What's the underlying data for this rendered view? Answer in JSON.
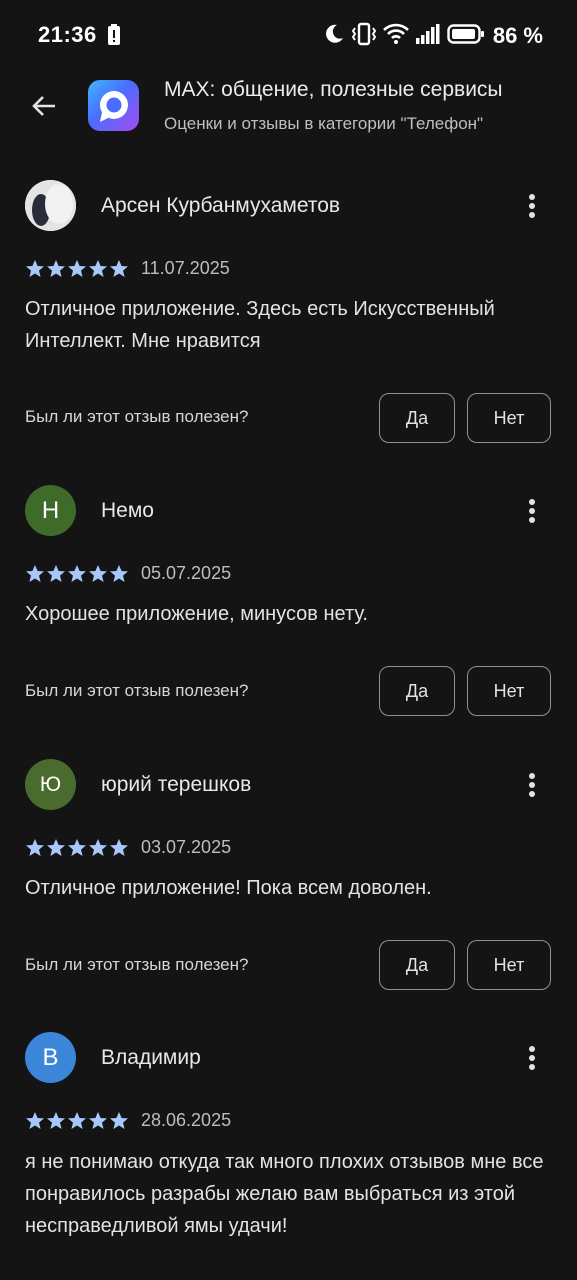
{
  "status": {
    "time": "21:36",
    "battery": "86 %"
  },
  "header": {
    "back_icon": "arrow-back-icon",
    "app_name": "MAX: общение, полезные сервисы",
    "subtitle": "Оценки и отзывы в категории \"Телефон\""
  },
  "colors": {
    "background": "#141414",
    "star": "#a8c7fa",
    "avatar_nemo": "#3e6b2a",
    "avatar_yuriy": "#4a6b2e",
    "avatar_vladimir": "#3b86d8"
  },
  "helpful_prompt": "Был ли этот отзыв полезен?",
  "yes_label": "Да",
  "no_label": "Нет",
  "reviews": [
    {
      "name": "Арсен Курбанмухаметов",
      "avatar_letter": "",
      "rating": 5,
      "date": "11.07.2025",
      "text": "Отличное приложение. Здесь есть Искусственный Интеллект. Мне нравится"
    },
    {
      "name": "Немо",
      "avatar_letter": "Н",
      "rating": 5,
      "date": "05.07.2025",
      "text": "Хорошее приложение, минусов нету."
    },
    {
      "name": "юрий терешков",
      "avatar_letter": "Ю",
      "rating": 5,
      "date": "03.07.2025",
      "text": "Отличное приложение! Пока всем доволен."
    },
    {
      "name": "Владимир",
      "avatar_letter": "В",
      "rating": 5,
      "date": "28.06.2025",
      "text": "я не понимаю откуда так много плохих отзывов мне все понравилось разрабы желаю вам выбраться из этой несправедливой ямы удачи!"
    }
  ]
}
